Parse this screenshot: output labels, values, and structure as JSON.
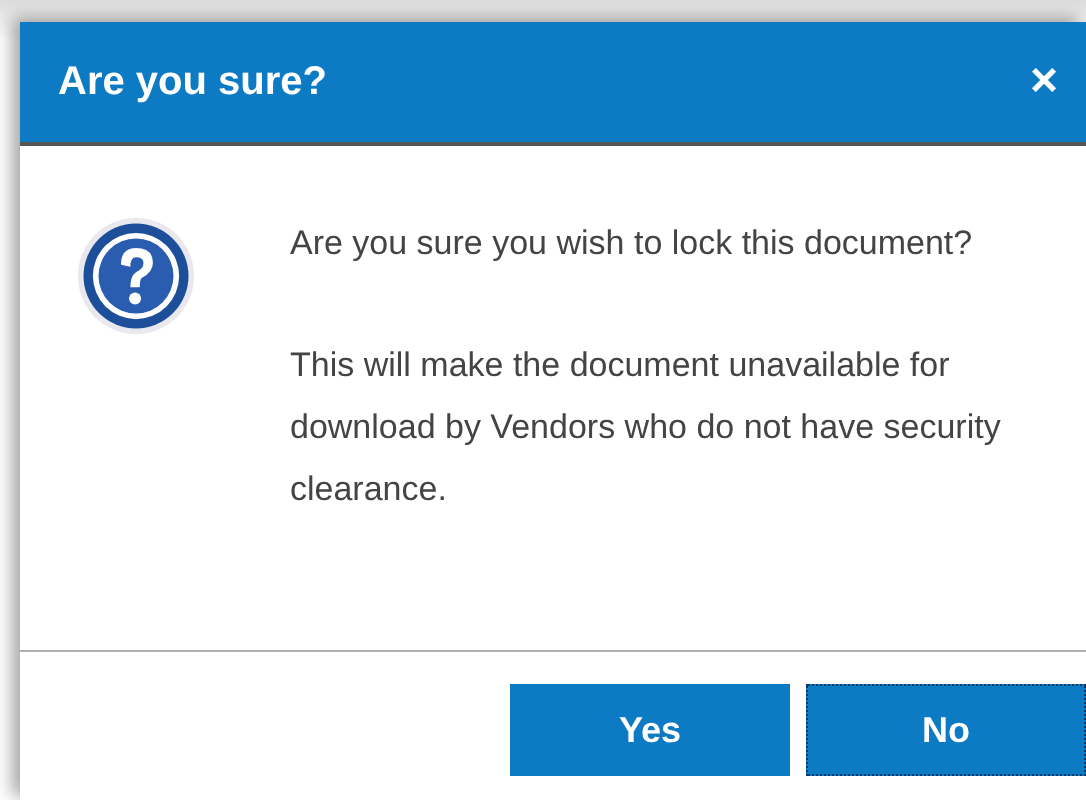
{
  "dialog": {
    "title": "Are you sure?",
    "close": "×"
  },
  "message": [
    "Are you sure you wish to lock this document?",
    "This will make the document unavailable for download by Vendors who do not have security clearance."
  ],
  "buttons": [
    {
      "label": "Yes",
      "focused": false
    },
    {
      "label": "No",
      "focused": true
    }
  ]
}
